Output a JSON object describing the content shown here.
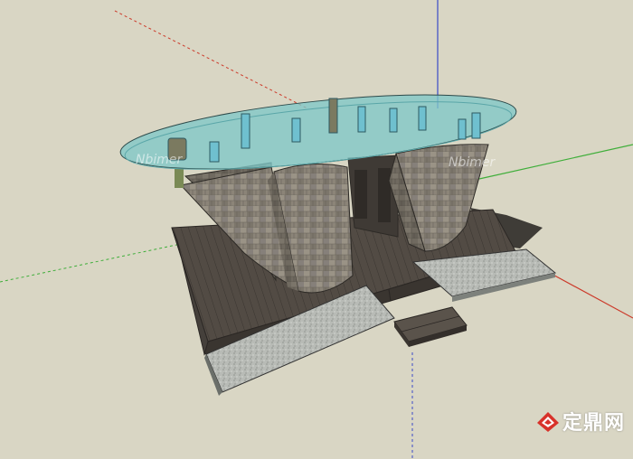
{
  "viewport": {
    "background": "#d9d6c4",
    "axis_colors": {
      "red": "#cc3a2a",
      "green": "#3fae3a",
      "blue": "#3a4ac8"
    }
  },
  "model": {
    "deck_color": "#4e4842",
    "glass_color": "#7fc8c8",
    "stone_color": "#8a8276",
    "ramp_color": "#b9bcb8",
    "pipe_color": "#6fc0cf"
  },
  "watermarks": {
    "scene_left": "Nbimer",
    "scene_right": "Nbimer",
    "site": "定鼎网",
    "logo": "dingding-logo"
  }
}
